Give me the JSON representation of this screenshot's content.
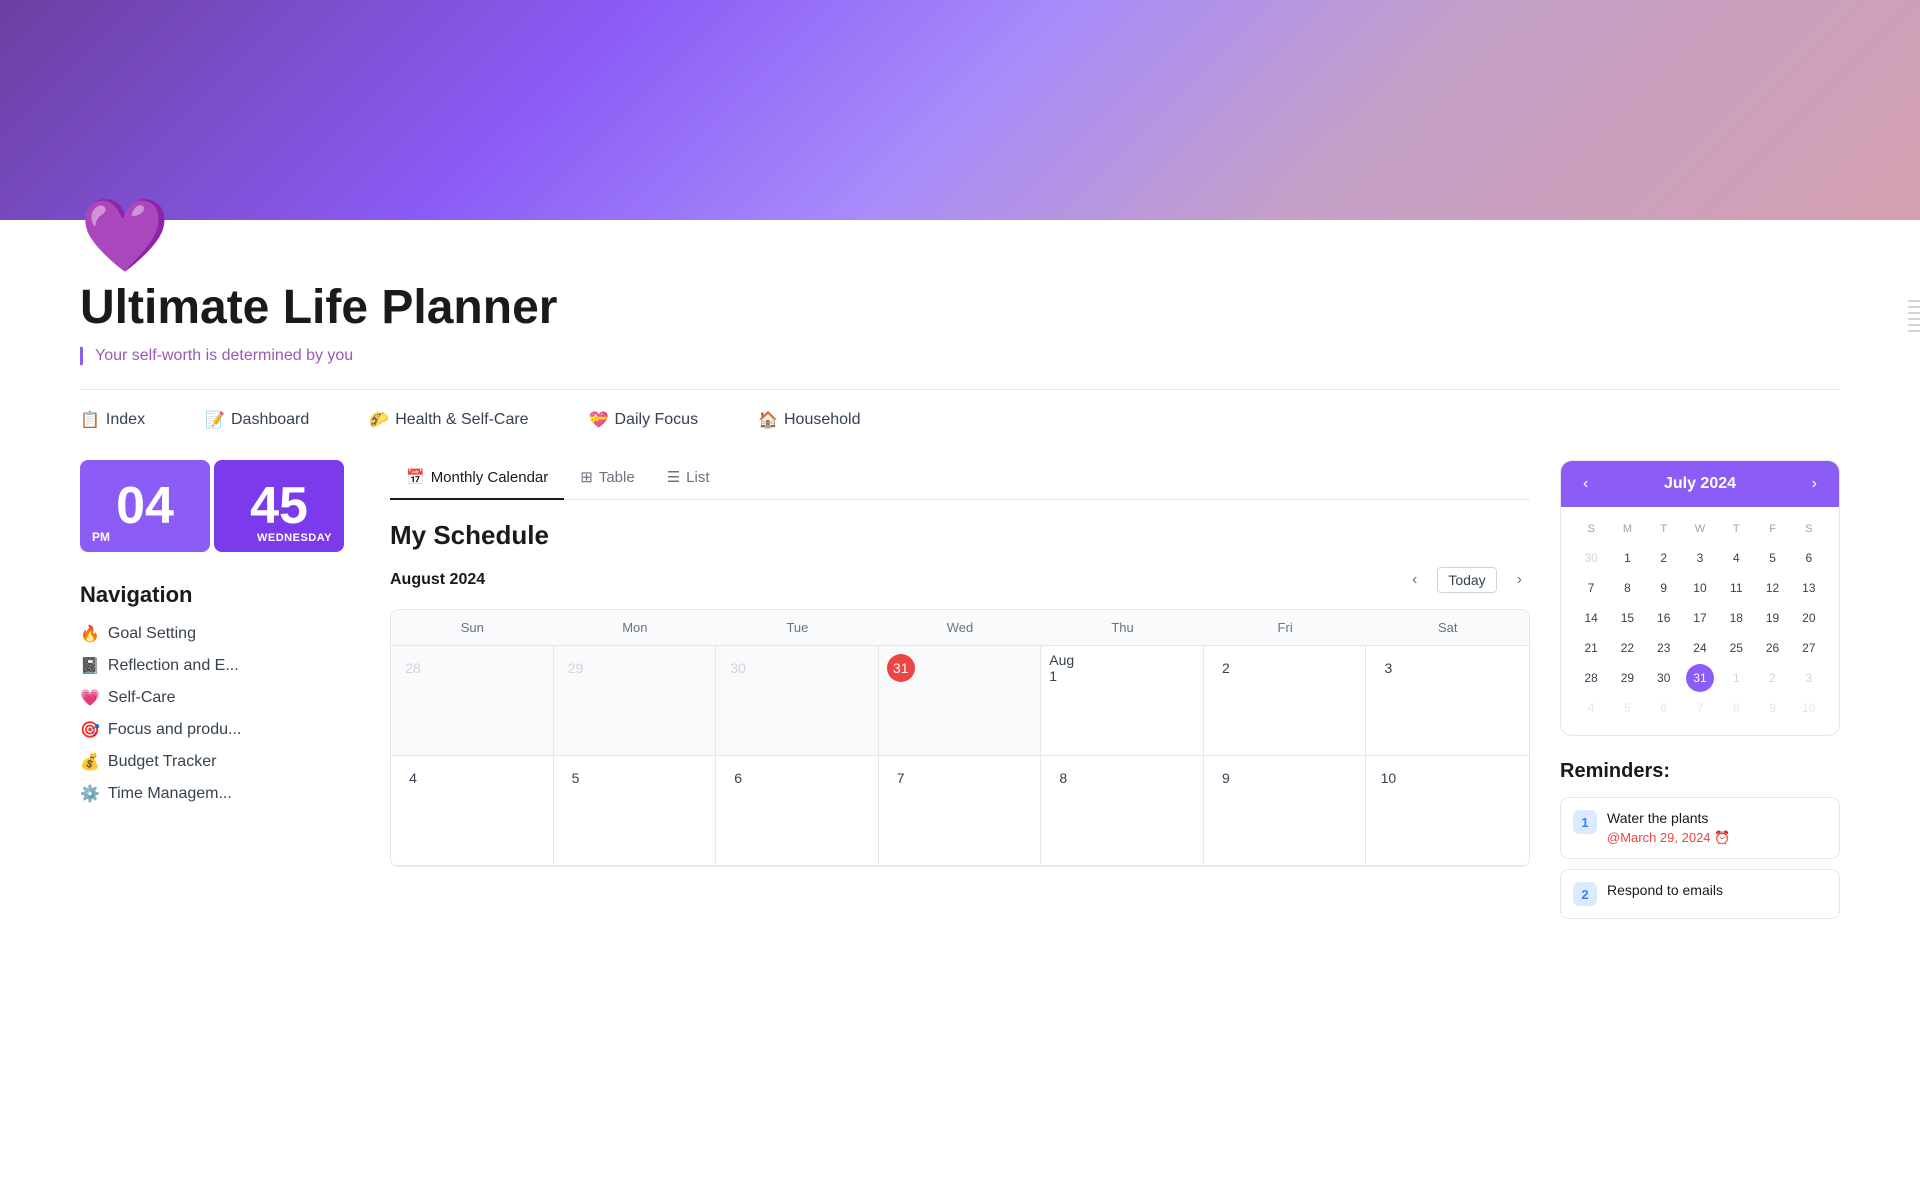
{
  "hero": {
    "banner_alt": "Purple gradient banner"
  },
  "page": {
    "icon": "💜",
    "title": "Ultimate Life Planner",
    "subtitle": "Your self-worth is determined by you"
  },
  "nav": {
    "items": [
      {
        "icon": "📋",
        "label": "Index"
      },
      {
        "icon": "📝",
        "label": "Dashboard"
      },
      {
        "icon": "🌮",
        "label": "Health & Self-Care"
      },
      {
        "icon": "💝",
        "label": "Daily Focus"
      },
      {
        "icon": "🏠",
        "label": "Household"
      }
    ]
  },
  "clock": {
    "hours": "04",
    "minutes": "45",
    "am_pm": "PM",
    "day": "WEDNESDAY"
  },
  "left_nav": {
    "title": "Navigation",
    "items": [
      {
        "icon": "🔥",
        "label": "Goal Setting"
      },
      {
        "icon": "📓",
        "label": "Reflection and E..."
      },
      {
        "icon": "💗",
        "label": "Self-Care"
      },
      {
        "icon": "🎯",
        "label": "Focus and produ..."
      },
      {
        "icon": "💰",
        "label": "Budget Tracker"
      },
      {
        "icon": "⚙️",
        "label": "Time Managem..."
      }
    ]
  },
  "calendar_tabs": [
    {
      "icon": "📅",
      "label": "Monthly Calendar",
      "active": true
    },
    {
      "icon": "⊞",
      "label": "Table",
      "active": false
    },
    {
      "icon": "☰",
      "label": "List",
      "active": false
    }
  ],
  "schedule": {
    "title": "My Schedule",
    "month": "August 2024",
    "today_label": "Today",
    "day_headers": [
      "Sun",
      "Mon",
      "Tue",
      "Wed",
      "Thu",
      "Fri",
      "Sat"
    ],
    "weeks": [
      [
        {
          "date": "28",
          "other": true
        },
        {
          "date": "29",
          "other": true
        },
        {
          "date": "30",
          "other": true
        },
        {
          "date": "31",
          "today": true,
          "other": true
        },
        {
          "date": "Aug 1",
          "first": true
        },
        {
          "date": "2"
        },
        {
          "date": "3"
        }
      ],
      [
        {
          "date": "4"
        },
        {
          "date": "5"
        },
        {
          "date": "6"
        },
        {
          "date": "7"
        },
        {
          "date": "8"
        },
        {
          "date": "9"
        },
        {
          "date": "10"
        }
      ]
    ]
  },
  "mini_calendar": {
    "title": "July 2024",
    "day_headers": [
      "S",
      "M",
      "T",
      "W",
      "T",
      "F",
      "S"
    ],
    "weeks": [
      [
        "30",
        "1",
        "2",
        "3",
        "4",
        "5",
        "6"
      ],
      [
        "7",
        "8",
        "9",
        "10",
        "11",
        "12",
        "13"
      ],
      [
        "14",
        "15",
        "16",
        "17",
        "18",
        "19",
        "20"
      ],
      [
        "21",
        "22",
        "23",
        "24",
        "25",
        "26",
        "27"
      ],
      [
        "28",
        "29",
        "30",
        "31",
        "1",
        "2",
        "3"
      ],
      [
        "4",
        "5",
        "6",
        "7",
        "8",
        "9",
        "10"
      ]
    ],
    "selected": "31",
    "other_month_first_row": [
      "30"
    ],
    "other_month_last_rows": [
      "1",
      "2",
      "3",
      "4",
      "5",
      "6",
      "7",
      "8",
      "9",
      "10"
    ]
  },
  "reminders": {
    "title": "Reminders:",
    "items": [
      {
        "number": "1",
        "text": "Water the plants",
        "date": "@March 29, 2024 ⏰"
      },
      {
        "number": "2",
        "text": "Respond to emails",
        "date": ""
      }
    ]
  }
}
